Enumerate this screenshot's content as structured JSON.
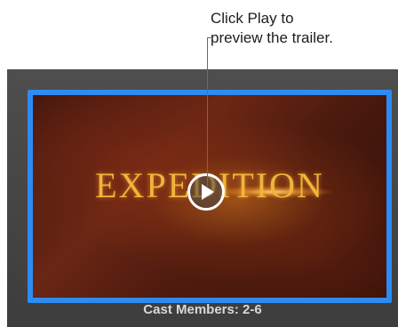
{
  "callout": {
    "line1": "Click Play to",
    "line2": "preview the trailer."
  },
  "trailer": {
    "title": "EXPEDITION",
    "play_icon": "play-icon"
  },
  "caption": "Cast Members: 2-6",
  "colors": {
    "selection_border": "#2c8cf4",
    "title_gold": "#f0b43a",
    "panel_bg": "#454545"
  }
}
